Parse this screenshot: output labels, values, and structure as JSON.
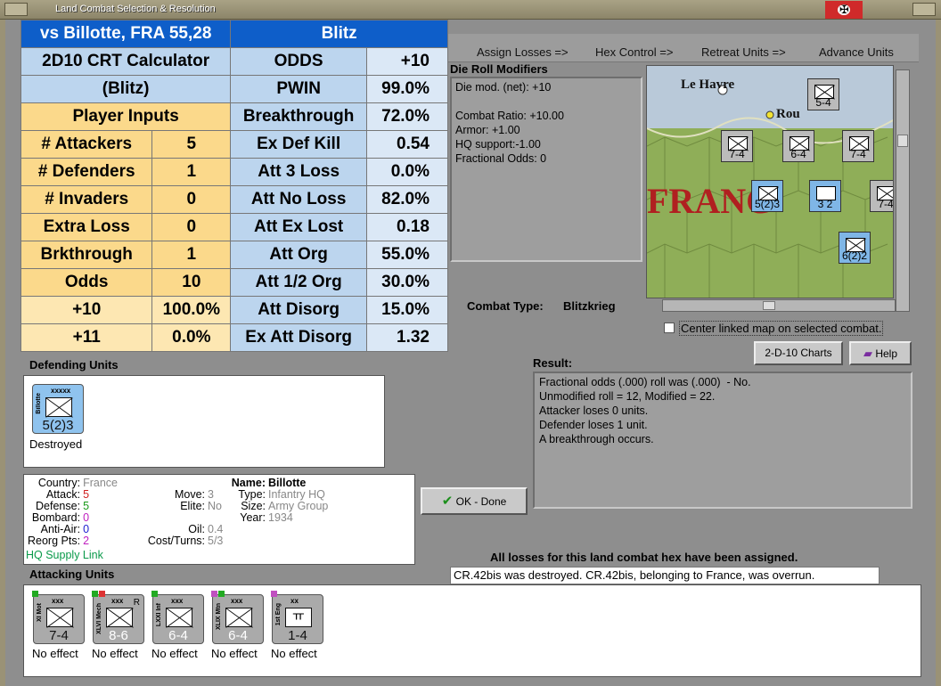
{
  "window": {
    "title": "Land Combat Selection & Resolution"
  },
  "crt": {
    "header_left": "vs Billotte, FRA 55,28",
    "header_right": "Blitz",
    "calc_title1": "2D10 CRT Calculator",
    "calc_title2": "(Blitz)",
    "player_inputs": "Player Inputs",
    "inputs": [
      {
        "label": "# Attackers",
        "value": "5"
      },
      {
        "label": "# Defenders",
        "value": "1"
      },
      {
        "label": "# Invaders",
        "value": "0"
      },
      {
        "label": "Extra Loss",
        "value": "0"
      },
      {
        "label": "Brkthrough",
        "value": "1"
      },
      {
        "label": "Odds",
        "value": "10"
      }
    ],
    "odds_rows": [
      {
        "label": "+10",
        "value": "100.0%"
      },
      {
        "label": "+11",
        "value": "0.0%"
      }
    ],
    "results": [
      {
        "label": "ODDS",
        "value": "+10"
      },
      {
        "label": "PWIN",
        "value": "99.0%"
      },
      {
        "label": "Breakthrough",
        "value": "72.0%"
      },
      {
        "label": "Ex Def Kill",
        "value": "0.54"
      },
      {
        "label": "Att 3 Loss",
        "value": "0.0%"
      },
      {
        "label": "Att No Loss",
        "value": "82.0%"
      },
      {
        "label": "Att Ex Lost",
        "value": "0.18"
      },
      {
        "label": "Att Org",
        "value": "55.0%"
      },
      {
        "label": "Att 1/2 Org",
        "value": "30.0%"
      },
      {
        "label": "Att Disorg",
        "value": "15.0%"
      },
      {
        "label": "Ex Att Disorg",
        "value": "1.32"
      }
    ]
  },
  "toolbar": {
    "assign_losses": "Assign Losses =>",
    "hex_control": "Hex Control =>",
    "retreat_units": "Retreat Units =>",
    "advance_units": "Advance Units"
  },
  "die_roll": {
    "title": "Die Roll Modifiers",
    "lines": "Die mod. (net): +10\n\nCombat Ratio: +10.00\nArmor: +1.00\nHQ support:-1.00\nFractional Odds: 0"
  },
  "combat_type": {
    "label": "Combat Type:",
    "value": "Blitzkrieg"
  },
  "map": {
    "city1": "Le Havre",
    "city2": "Rou",
    "country": "FRANC",
    "center_linked": "Center linked map on selected combat.",
    "counters": [
      {
        "size": "xxx",
        "str": "5-4"
      },
      {
        "size": "xxx",
        "str": "7-4"
      },
      {
        "size": "xxx",
        "str": "6-4"
      },
      {
        "size": "xxx",
        "str": "7-4"
      },
      {
        "size": "xxxxx",
        "str": "5(2)3"
      },
      {
        "size": "xx",
        "str": "3 2"
      },
      {
        "size": "xxx",
        "str": "7-4"
      },
      {
        "size": "xxx",
        "str": "6(2)2"
      }
    ]
  },
  "buttons": {
    "charts": "2-D-10 Charts",
    "help": "Help",
    "ok": "OK - Done"
  },
  "result": {
    "title": "Result:",
    "lines": "Fractional odds (.000) roll was (.000)  - No.\nUnmodified roll = 12, Modified = 22.\nAttacker loses 0 units.\nDefender loses 1 unit.\nA breakthrough occurs."
  },
  "defending": {
    "title": "Defending Units",
    "unit": {
      "size": "xxxxx",
      "side": "Billotte",
      "str": "5(2)3",
      "status": "Destroyed"
    }
  },
  "info": {
    "country_k": "Country:",
    "country_v": "France",
    "attack_k": "Attack:",
    "attack_v": "5",
    "defense_k": "Defense:",
    "defense_v": "5",
    "bombard_k": "Bombard:",
    "bombard_v": "0",
    "antiair_k": "Anti-Air:",
    "antiair_v": "0",
    "reorg_k": "Reorg Pts:",
    "reorg_v": "2",
    "move_k": "Move:",
    "move_v": "3",
    "elite_k": "Elite:",
    "elite_v": "No",
    "oil_k": "Oil:",
    "oil_v": "0.4",
    "cost_k": "Cost/Turns:",
    "cost_v": "5/3",
    "name_k": "Name:",
    "name_v": "Billotte",
    "type_k": "Type:",
    "type_v": "Infantry HQ",
    "size_k": "Size:",
    "size_v": "Army Group",
    "year_k": "Year:",
    "year_v": "1934",
    "hq_link": "HQ Supply Link"
  },
  "messages": {
    "losses_assigned": "All losses for this land combat hex have been assigned.",
    "log": "CR.42bis was destroyed.  CR.42bis, belonging to France, was overrun."
  },
  "attacking": {
    "title": "Attacking Units",
    "units": [
      {
        "size": "xxx",
        "side": "XI Mot",
        "str": "7-4",
        "status": "No effect"
      },
      {
        "size": "xxx",
        "side": "XLVI Mech",
        "str": "8-6",
        "status": "No effect",
        "tag": "R"
      },
      {
        "size": "xxx",
        "side": "LXXI Inf",
        "str": "6-4",
        "status": "No effect"
      },
      {
        "size": "xxx",
        "side": "XLIX Mtn",
        "str": "6-4",
        "status": "No effect"
      },
      {
        "size": "xx",
        "side": "1st Eng",
        "str": "1-4",
        "status": "No effect"
      }
    ]
  },
  "colors": {
    "header_blue": "#0e5ec9",
    "input_yellow": "#fbd98b",
    "result_blue": "#bcd5ee",
    "hq_green": "#0a9a4a"
  }
}
